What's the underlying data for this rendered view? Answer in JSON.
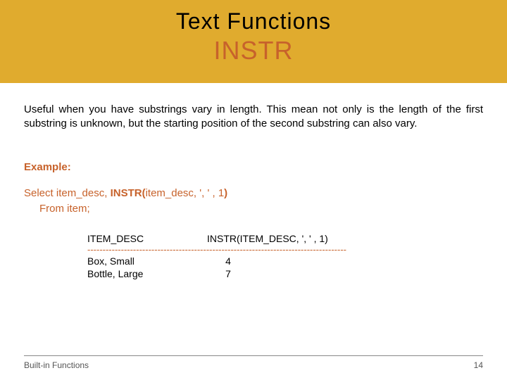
{
  "header": {
    "title": "Text Functions",
    "subtitle": "INSTR"
  },
  "body": {
    "description": "Useful  when you have substrings vary in length. This mean not only is the length of the first substring is unknown, but the starting position of the second substring can also vary.",
    "example_label": "Example:",
    "query_line1_a": "Select  item_desc, ",
    "query_line1_b": "INSTR(",
    "query_line1_c": "item_desc, ', ' , 1",
    "query_line1_d": ")",
    "query_line2": "From item;"
  },
  "result": {
    "col1_header": "ITEM_DESC",
    "col2_header": "INSTR(ITEM_DESC, ', ' , 1)",
    "divider": "-------------------------------------------------------------------------------------",
    "rows": [
      {
        "desc": "Box, Small",
        "val": "4"
      },
      {
        "desc": "Bottle, Large",
        "val": "7"
      }
    ]
  },
  "footer": {
    "left": "Built-in Functions",
    "right": "14"
  }
}
